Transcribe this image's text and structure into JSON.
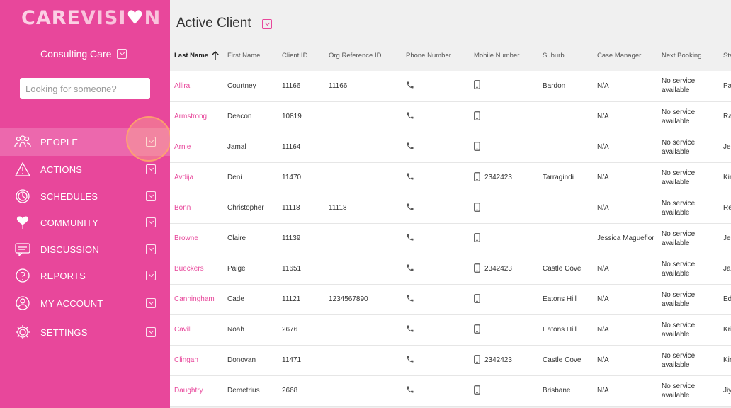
{
  "sidebar": {
    "logo": {
      "part1": "CARE",
      "part2": "VISI",
      "heart": "♥",
      "part3": "N"
    },
    "org_name": "Consulting Care",
    "search_placeholder": "Looking for someone?",
    "items": [
      {
        "label": "PEOPLE",
        "icon": "people-icon",
        "active": true
      },
      {
        "label": "ACTIONS",
        "icon": "warning-icon"
      },
      {
        "label": "SCHEDULES",
        "icon": "clock-icon"
      },
      {
        "label": "COMMUNITY",
        "icon": "heart-icon"
      },
      {
        "label": "DISCUSSION",
        "icon": "chat-icon"
      },
      {
        "label": "REPORTS",
        "icon": "reports-icon"
      },
      {
        "label": "MY ACCOUNT",
        "icon": "user-icon"
      },
      {
        "label": "SETTINGS",
        "icon": "gear-icon"
      }
    ],
    "accent_color": "#e8479b"
  },
  "main": {
    "title": "Active Client",
    "columns": [
      "Last Name",
      "First Name",
      "Client ID",
      "Org Reference ID",
      "Phone Number",
      "Mobile Number",
      "Suburb",
      "Case Manager",
      "Next Booking",
      "Sta"
    ],
    "sort_column": "Last Name",
    "sort_direction": "ascending",
    "rows": [
      {
        "last": "Allira",
        "first": "Courtney",
        "id": "11166",
        "org_ref": "11166",
        "mobile": "",
        "suburb": "Bardon",
        "case_manager": "N/A",
        "next_booking": "No service available",
        "status": "Pa"
      },
      {
        "last": "Armstrong",
        "first": "Deacon",
        "id": "10819",
        "org_ref": "",
        "mobile": "",
        "suburb": "",
        "case_manager": "N/A",
        "next_booking": "No service available",
        "status": "Ra"
      },
      {
        "last": "Arnie",
        "first": "Jamal",
        "id": "11164",
        "org_ref": "",
        "mobile": "",
        "suburb": "",
        "case_manager": "N/A",
        "next_booking": "No service available",
        "status": "Jer"
      },
      {
        "last": "Avdija",
        "first": "Deni",
        "id": "11470",
        "org_ref": "",
        "mobile": "2342423",
        "suburb": "Tarragindi",
        "case_manager": "N/A",
        "next_booking": "No service available",
        "status": "Kir"
      },
      {
        "last": "Bonn",
        "first": "Christopher",
        "id": "11118",
        "org_ref": "11118",
        "mobile": "",
        "suburb": "",
        "case_manager": "N/A",
        "next_booking": "No service available",
        "status": "Re"
      },
      {
        "last": "Browne",
        "first": "Claire",
        "id": "11139",
        "org_ref": "",
        "mobile": "",
        "suburb": "",
        "case_manager": "Jessica Magueflor",
        "next_booking": "No service available",
        "status": "Jes"
      },
      {
        "last": "Bueckers",
        "first": "Paige",
        "id": "11651",
        "org_ref": "",
        "mobile": "2342423",
        "suburb": "Castle Cove",
        "case_manager": "N/A",
        "next_booking": "No service available",
        "status": "Jal"
      },
      {
        "last": "Canningham",
        "first": "Cade",
        "id": "11121",
        "org_ref": "1234567890",
        "mobile": "",
        "suburb": "Eatons Hill",
        "case_manager": "N/A",
        "next_booking": "No service available",
        "status": "Ed"
      },
      {
        "last": "Cavill",
        "first": "Noah",
        "id": "2676",
        "org_ref": "",
        "mobile": "",
        "suburb": "Eatons Hill",
        "case_manager": "N/A",
        "next_booking": "No service available",
        "status": "Kri"
      },
      {
        "last": "Clingan",
        "first": "Donovan",
        "id": "11471",
        "org_ref": "",
        "mobile": "2342423",
        "suburb": "Castle Cove",
        "case_manager": "N/A",
        "next_booking": "No service available",
        "status": "Kir"
      },
      {
        "last": "Daughtry",
        "first": "Demetrius",
        "id": "2668",
        "org_ref": "",
        "mobile": "",
        "suburb": "Brisbane",
        "case_manager": "N/A",
        "next_booking": "No service available",
        "status": "Jiy"
      }
    ]
  }
}
